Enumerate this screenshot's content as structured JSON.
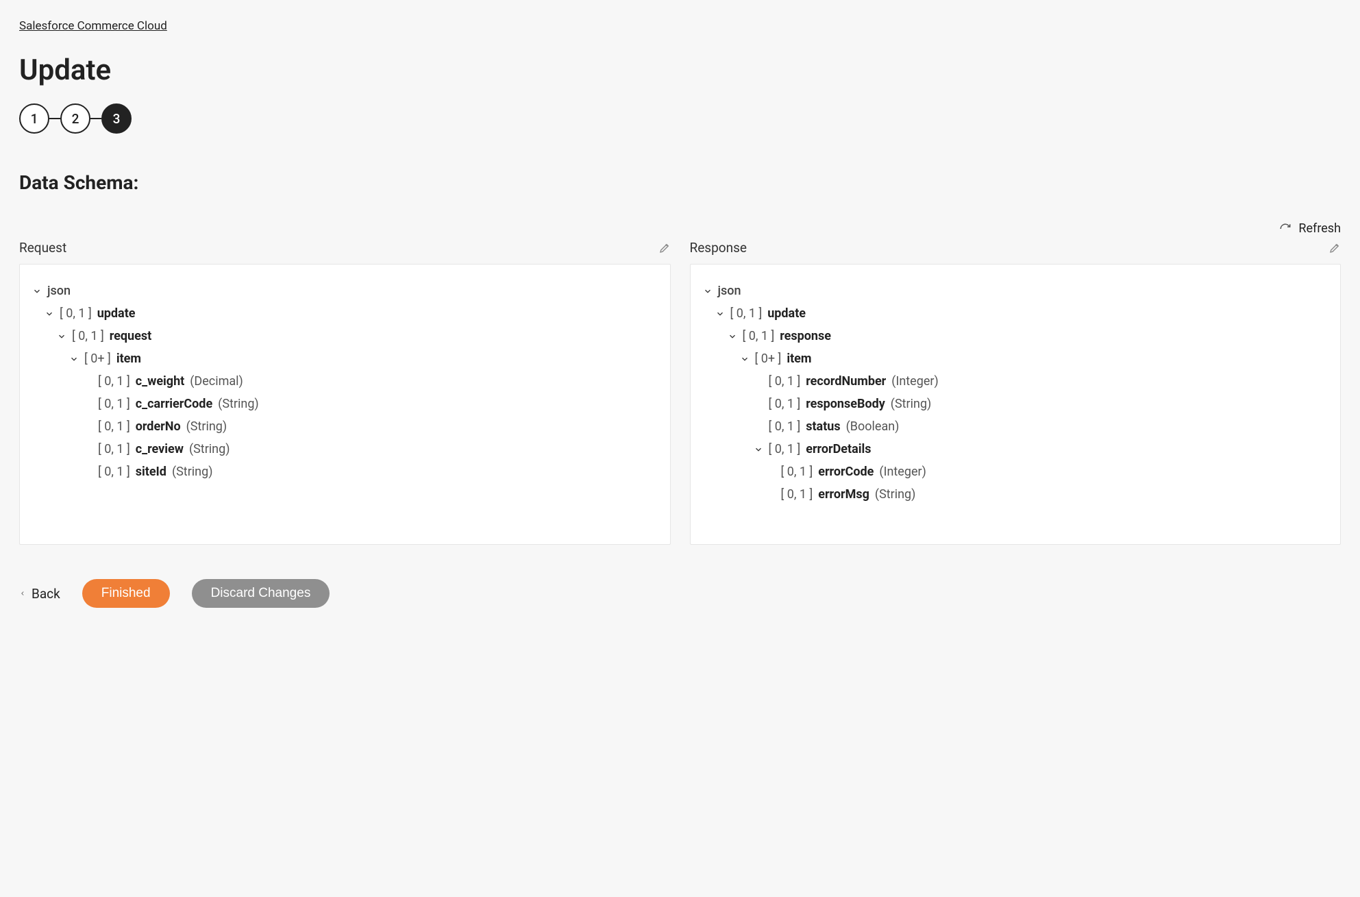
{
  "breadcrumb": "Salesforce Commerce Cloud",
  "title": "Update",
  "stepper": {
    "steps": [
      "1",
      "2",
      "3"
    ],
    "active": 2
  },
  "section": "Data Schema:",
  "refresh": "Refresh",
  "columns": {
    "request": {
      "title": "Request"
    },
    "response": {
      "title": "Response"
    }
  },
  "req": {
    "root": "json",
    "n0": {
      "card": "[ 0, 1 ]",
      "name": "update"
    },
    "n1": {
      "card": "[ 0, 1 ]",
      "name": "request"
    },
    "n2": {
      "card": "[ 0+ ]",
      "name": "item"
    },
    "leaf0": {
      "card": "[ 0, 1 ]",
      "name": "c_weight",
      "type": "(Decimal)"
    },
    "leaf1": {
      "card": "[ 0, 1 ]",
      "name": "c_carrierCode",
      "type": "(String)"
    },
    "leaf2": {
      "card": "[ 0, 1 ]",
      "name": "orderNo",
      "type": "(String)"
    },
    "leaf3": {
      "card": "[ 0, 1 ]",
      "name": "c_review",
      "type": "(String)"
    },
    "leaf4": {
      "card": "[ 0, 1 ]",
      "name": "siteId",
      "type": "(String)"
    }
  },
  "res": {
    "root": "json",
    "n0": {
      "card": "[ 0, 1 ]",
      "name": "update"
    },
    "n1": {
      "card": "[ 0, 1 ]",
      "name": "response"
    },
    "n2": {
      "card": "[ 0+ ]",
      "name": "item"
    },
    "leaf0": {
      "card": "[ 0, 1 ]",
      "name": "recordNumber",
      "type": "(Integer)"
    },
    "leaf1": {
      "card": "[ 0, 1 ]",
      "name": "responseBody",
      "type": "(String)"
    },
    "leaf2": {
      "card": "[ 0, 1 ]",
      "name": "status",
      "type": "(Boolean)"
    },
    "n3": {
      "card": "[ 0, 1 ]",
      "name": "errorDetails"
    },
    "leaf3": {
      "card": "[ 0, 1 ]",
      "name": "errorCode",
      "type": "(Integer)"
    },
    "leaf4": {
      "card": "[ 0, 1 ]",
      "name": "errorMsg",
      "type": "(String)"
    }
  },
  "footer": {
    "back": "Back",
    "finished": "Finished",
    "discard": "Discard Changes"
  }
}
